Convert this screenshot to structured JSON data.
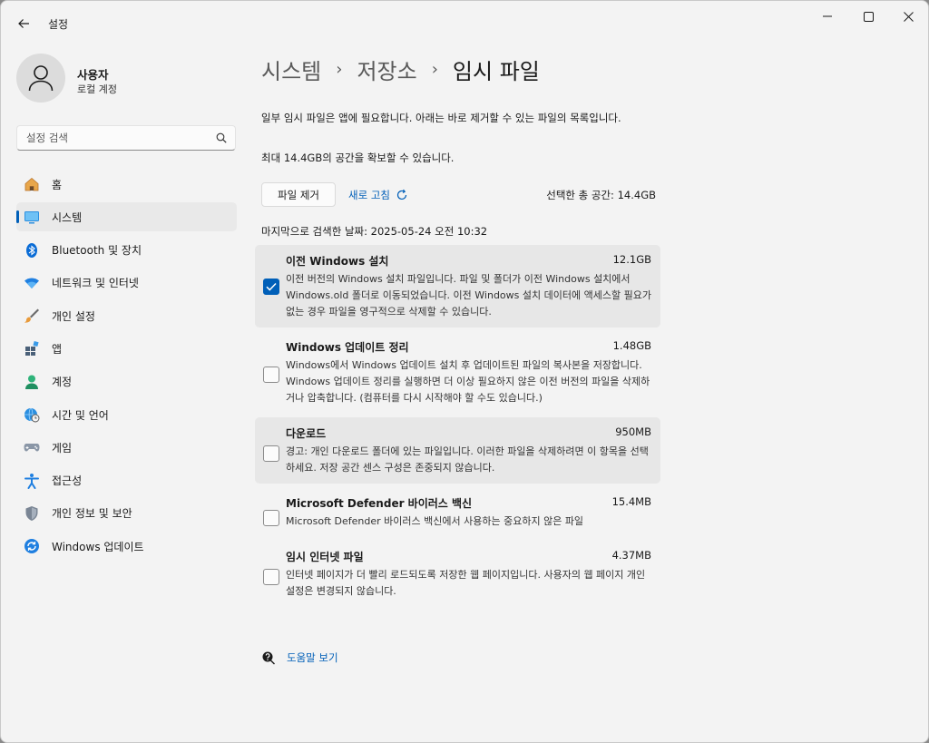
{
  "window": {
    "title": "설정"
  },
  "user": {
    "name": "사용자",
    "account": "로컬 계정"
  },
  "search": {
    "placeholder": "설정 검색"
  },
  "nav": [
    {
      "label": "홈",
      "icon": "home-icon"
    },
    {
      "label": "시스템",
      "icon": "system-icon",
      "active": true
    },
    {
      "label": "Bluetooth 및 장치",
      "icon": "bluetooth-icon"
    },
    {
      "label": "네트워크 및 인터넷",
      "icon": "wifi-icon"
    },
    {
      "label": "개인 설정",
      "icon": "brush-icon"
    },
    {
      "label": "앱",
      "icon": "apps-icon"
    },
    {
      "label": "계정",
      "icon": "account-icon"
    },
    {
      "label": "시간 및 언어",
      "icon": "globe-clock-icon"
    },
    {
      "label": "게임",
      "icon": "gamepad-icon"
    },
    {
      "label": "접근성",
      "icon": "accessibility-icon"
    },
    {
      "label": "개인 정보 및 보안",
      "icon": "shield-icon"
    },
    {
      "label": "Windows 업데이트",
      "icon": "update-icon"
    }
  ],
  "breadcrumb": [
    "시스템",
    "저장소",
    "임시 파일"
  ],
  "description": "일부 임시 파일은 앱에 필요합니다. 아래는 바로 제거할 수 있는 파일의 목록입니다.",
  "max_space": "최대 14.4GB의 공간을 확보할 수 있습니다.",
  "actions": {
    "remove": "파일 제거",
    "refresh": "새로 고침"
  },
  "selected_total": "선택한 총 공간: 14.4GB",
  "last_scan": "마지막으로 검색한 날짜: 2025-05-24 오전 10:32",
  "items": [
    {
      "name": "이전 Windows 설치",
      "size": "12.1GB",
      "checked": true,
      "desc": "이전 버전의 Windows 설치 파일입니다. 파일 및 폴더가 이전 Windows 설치에서 Windows.old 폴더로 이동되었습니다. 이전 Windows 설치 데이터에 액세스할 필요가 없는 경우 파일을 영구적으로 삭제할 수 있습니다."
    },
    {
      "name": "Windows 업데이트 정리",
      "size": "1.48GB",
      "checked": false,
      "desc": "Windows에서 Windows 업데이트 설치 후 업데이트된 파일의 복사본을 저장합니다. Windows 업데이트 정리를 실행하면 더 이상 필요하지 않은 이전 버전의 파일을 삭제하거나 압축합니다. (컴퓨터를 다시 시작해야 할 수도 있습니다.)"
    },
    {
      "name": "다운로드",
      "size": "950MB",
      "checked": false,
      "desc": "경고: 개인 다운로드 폴더에 있는 파일입니다. 이러한 파일을 삭제하려면 이 항목을 선택하세요. 저장 공간 센스 구성은 존중되지 않습니다."
    },
    {
      "name": "Microsoft Defender 바이러스 백신",
      "size": "15.4MB",
      "checked": false,
      "desc": "Microsoft Defender 바이러스 백신에서 사용하는 중요하지 않은 파일"
    },
    {
      "name": "임시 인터넷 파일",
      "size": "4.37MB",
      "checked": false,
      "desc": "인터넷 페이지가 더 빨리 로드되도록 저장한 웹 페이지입니다. 사용자의 웹 페이지 개인 설정은 변경되지 않습니다."
    }
  ],
  "help": {
    "label": "도움말 보기"
  },
  "colors": {
    "accent": "#005fb8",
    "background": "#f3f3f3"
  }
}
